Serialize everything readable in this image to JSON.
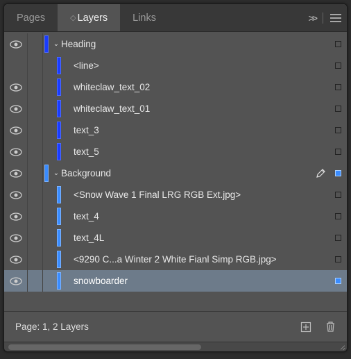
{
  "tabs": {
    "pages": "Pages",
    "layers": "Layers",
    "links": "Links",
    "active": "layers"
  },
  "layers": [
    {
      "id": "heading",
      "label": "Heading",
      "depth": 0,
      "group": true,
      "color": "blue1",
      "visible": true,
      "swatch": "hollow",
      "selected": false,
      "pen": false
    },
    {
      "id": "line",
      "label": "<line>",
      "depth": 1,
      "group": false,
      "color": "blue1",
      "visible": false,
      "swatch": "hollow",
      "selected": false,
      "pen": false
    },
    {
      "id": "wc2",
      "label": "whiteclaw_text_02",
      "depth": 1,
      "group": false,
      "color": "blue1",
      "visible": true,
      "swatch": "hollow",
      "selected": false,
      "pen": false
    },
    {
      "id": "wc1",
      "label": "whiteclaw_text_01",
      "depth": 1,
      "group": false,
      "color": "blue1",
      "visible": true,
      "swatch": "hollow",
      "selected": false,
      "pen": false
    },
    {
      "id": "t3",
      "label": "text_3",
      "depth": 1,
      "group": false,
      "color": "blue1",
      "visible": true,
      "swatch": "hollow",
      "selected": false,
      "pen": false
    },
    {
      "id": "t5",
      "label": "text_5",
      "depth": 1,
      "group": false,
      "color": "blue1",
      "visible": true,
      "swatch": "hollow",
      "selected": false,
      "pen": false
    },
    {
      "id": "bg",
      "label": "Background",
      "depth": 0,
      "group": true,
      "color": "blue2",
      "visible": true,
      "swatch": "blue2",
      "selected": false,
      "pen": true
    },
    {
      "id": "snowwave",
      "label": "<Snow Wave 1 Final LRG RGB Ext.jpg>",
      "depth": 1,
      "group": false,
      "color": "blue2",
      "visible": true,
      "swatch": "hollow",
      "selected": false,
      "pen": false
    },
    {
      "id": "t4",
      "label": "text_4",
      "depth": 1,
      "group": false,
      "color": "blue2",
      "visible": true,
      "swatch": "hollow",
      "selected": false,
      "pen": false
    },
    {
      "id": "t4l",
      "label": "text_4L",
      "depth": 1,
      "group": false,
      "color": "blue2",
      "visible": true,
      "swatch": "hollow",
      "selected": false,
      "pen": false
    },
    {
      "id": "c9290",
      "label": "<9290 C...a Winter 2 White Fianl Simp RGB.jpg>",
      "depth": 1,
      "group": false,
      "color": "blue2",
      "visible": true,
      "swatch": "hollow",
      "selected": false,
      "pen": false
    },
    {
      "id": "snowboarder",
      "label": "snowboarder",
      "depth": 1,
      "group": false,
      "color": "blue2",
      "visible": true,
      "swatch": "blue2",
      "selected": true,
      "pen": false
    }
  ],
  "footer": {
    "status": "Page: 1, 2 Layers"
  }
}
